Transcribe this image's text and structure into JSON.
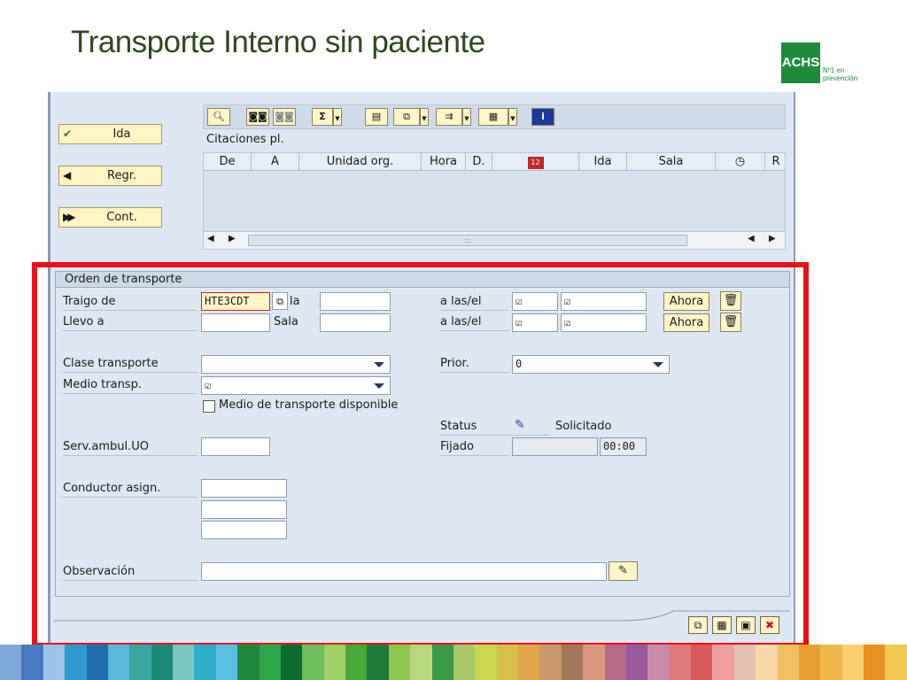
{
  "slide": {
    "title": "Transporte Interno sin paciente",
    "logo": {
      "brand": "ACHS",
      "tagline_line1": "Nº1 en",
      "tagline_line2": "prevención"
    }
  },
  "nav_buttons": [
    {
      "label": "Ida",
      "icon": "check-icon"
    },
    {
      "label": "Regr.",
      "icon": "arrow-left-icon"
    },
    {
      "label": "Cont.",
      "icon": "fast-forward-icon"
    }
  ],
  "toolbar": {
    "icons": [
      "magnifier-icon",
      "binoculars-icon",
      "binoculars-next-icon",
      "sum-icon",
      "print-icon",
      "export-icon",
      "save-layout-icon",
      "columns-icon",
      "info-icon"
    ]
  },
  "citaciones": {
    "label": "Citaciones pl.",
    "columns": [
      "De",
      "A",
      "Unidad org.",
      "Hora",
      "D.",
      "",
      "Ida",
      "Sala",
      "",
      "R"
    ],
    "column_icons": [
      "calendar-icon",
      "clock-icon"
    ],
    "scroll_grip": ":::"
  },
  "orden": {
    "title": "Orden de transporte",
    "traigo_de": {
      "label": "Traigo de",
      "value": "HTE3CDT",
      "sala_label": "la",
      "sala_value": ""
    },
    "llevo_a": {
      "label": "Llevo a",
      "value": "",
      "sala_label": "Sala",
      "sala_value": ""
    },
    "a_las_label": "a las/el",
    "check_mark": "☑",
    "ahora_label": "Ahora",
    "clase_transporte": {
      "label": "Clase transporte",
      "value": ""
    },
    "prior": {
      "label": "Prior.",
      "value": "0"
    },
    "medio_transp": {
      "label": "Medio transp.",
      "value": "☑"
    },
    "medio_disponible": {
      "label": "Medio de transporte disponible",
      "checked": false
    },
    "status": {
      "label": "Status",
      "value": "Solicitado"
    },
    "fijado": {
      "label": "Fijado",
      "date": "",
      "time": "00:00"
    },
    "serv_ambul": {
      "label": "Serv.ambul.UO",
      "value": ""
    },
    "conductor": {
      "label": "Conductor asign.",
      "values": [
        "",
        "",
        ""
      ]
    },
    "observacion": {
      "label": "Observación",
      "value": ""
    }
  },
  "bottom_buttons": [
    "copy-icon",
    "calculator-icon",
    "save-icon",
    "cancel-icon"
  ],
  "colors": {
    "highlight_frame": "#e8121a",
    "sap_background": "#dfe8f2",
    "button_yellow": "#fff6c8",
    "brand_green": "#1e8a3c",
    "title_green": "#2e4a1f"
  }
}
